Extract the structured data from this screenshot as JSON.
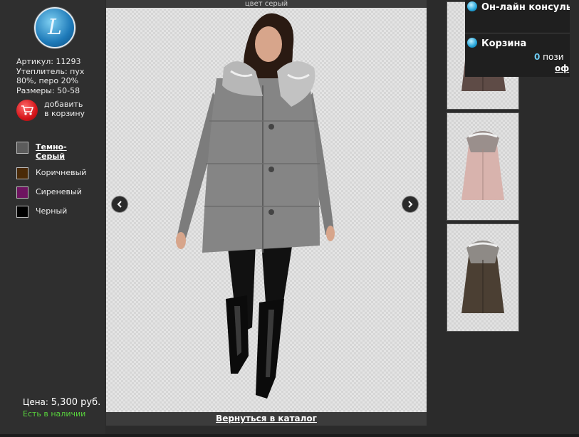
{
  "logo": {
    "glyph": "L"
  },
  "product": {
    "sku": "Артикул: 11293",
    "filling_line1": "Утеплитель: пух",
    "filling_line2": "80%, перо 20%",
    "sizes": "Размеры: 50-58"
  },
  "add_to_cart": {
    "line1": "добавить",
    "line2": "в корзину",
    "icon": "shopping-cart-icon"
  },
  "colors": [
    {
      "label_line1": "Темно-",
      "label_line2": "Серый",
      "hex": "#5c5c5c",
      "active": true
    },
    {
      "label": "Коричневый",
      "hex": "#4a2a08"
    },
    {
      "label": "Сиреневый",
      "hex": "#6e1460"
    },
    {
      "label": "Черный",
      "hex": "#000000"
    }
  ],
  "price": {
    "label": "Цена:",
    "value": "5,300 руб."
  },
  "stock": "Есть в наличии",
  "viewer": {
    "caption": "цвет серый",
    "back_link": "Вернуться в каталог",
    "prev_icon": "chevron-left-icon",
    "next_icon": "chevron-right-icon"
  },
  "thumbnails": [
    {
      "color": "#5e4b46"
    },
    {
      "color": "#d8b3ad"
    },
    {
      "color": "#4b3f33"
    }
  ],
  "side_panel": {
    "consult": "Он-лайн консульт",
    "cart": "Корзина",
    "cart_count_num": "0",
    "cart_count_rest": " пози",
    "cart_link": "оф"
  }
}
